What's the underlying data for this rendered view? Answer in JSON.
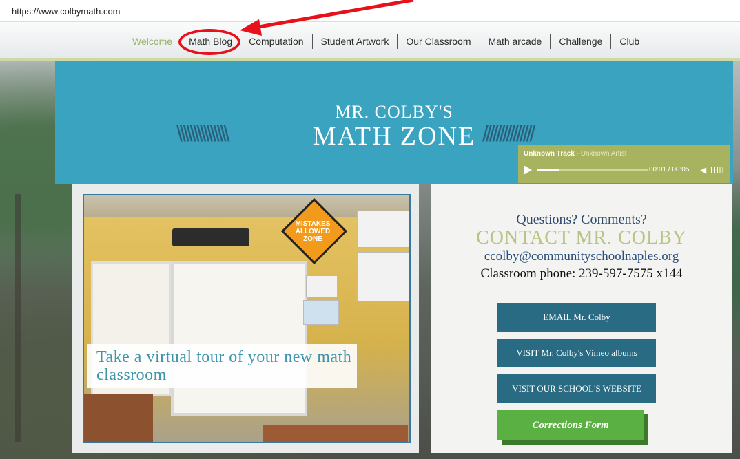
{
  "browser": {
    "url": "https://www.colbymath.com"
  },
  "nav": {
    "items": [
      {
        "label": "Welcome",
        "active": true
      },
      {
        "label": "Math Blog"
      },
      {
        "label": "Computation"
      },
      {
        "label": "Student Artwork"
      },
      {
        "label": "Our Classroom"
      },
      {
        "label": "Math arcade"
      },
      {
        "label": "Challenge"
      },
      {
        "label": "Club"
      }
    ]
  },
  "banner": {
    "subtitle": "MR. COLBY'S",
    "title": "MATH ZONE",
    "left_deco": "\\\\\\\\\\\\\\\\\\\\\\\\\\\\\\",
    "right_deco": "///////////////"
  },
  "player": {
    "track": "Unknown Track",
    "separator": " - ",
    "artist": "Unknown Artist",
    "time": "00:01 / 00:05",
    "progress": 0.2
  },
  "tour": {
    "text": "Take a virtual tour of your new math classroom",
    "sign_text": "MISTAKES ALLOWED ZONE"
  },
  "contact": {
    "question": "Questions? Comments?",
    "title": "CONTACT MR. COLBY",
    "email": "ccolby@communityschoolnaples.org",
    "phone": "Classroom phone: 239-597-7575 x144"
  },
  "buttons": {
    "email": "EMAIL Mr. Colby",
    "vimeo": "VISIT Mr. Colby's Vimeo albums",
    "school": "VISIT OUR SCHOOL'S WEBSITE",
    "corrections": "Corrections Form"
  },
  "colors": {
    "banner": "#3aa3c0",
    "button": "#2a6b84",
    "green_button": "#5ab043",
    "annotation": "#e8101a",
    "nav_active": "#9ab16b"
  }
}
